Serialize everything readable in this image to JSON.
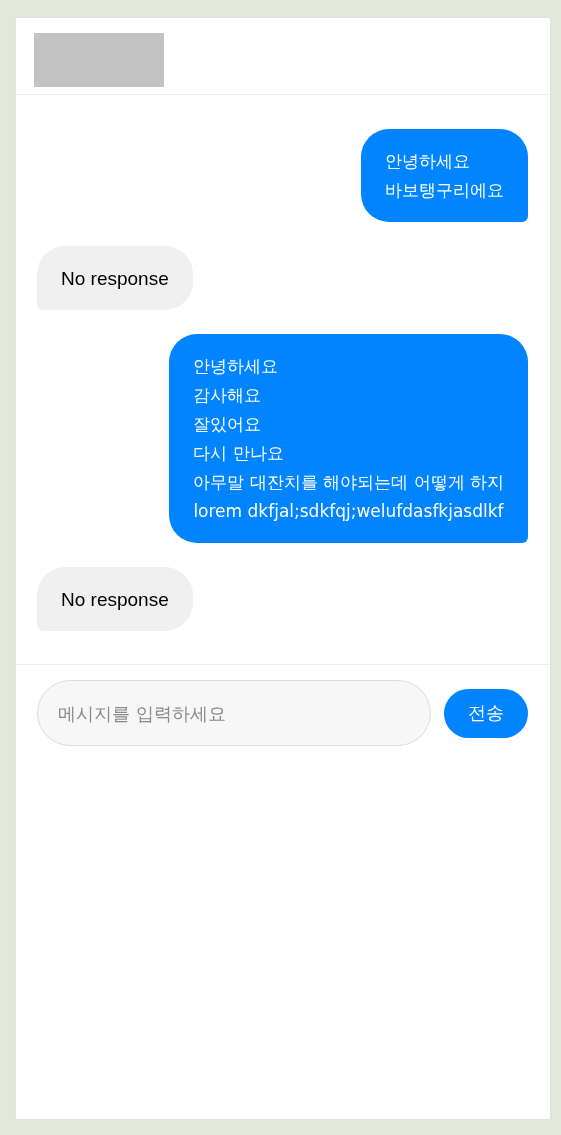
{
  "messages": [
    {
      "kind": "user",
      "text": "안녕하세요\n바보탱구리에요"
    },
    {
      "kind": "bot",
      "text": "No response"
    },
    {
      "kind": "user",
      "text": "안녕하세요\n감사해요\n잘있어요\n다시 만나요\n아무말 대잔치를 해야되는데 어떻게 하지\nlorem dkfjal;sdkfqj;welufdasfkjasdlkf"
    },
    {
      "kind": "bot",
      "text": "No response"
    }
  ],
  "composer": {
    "placeholder": "메시지를 입력하세요",
    "send_button": "전송"
  }
}
